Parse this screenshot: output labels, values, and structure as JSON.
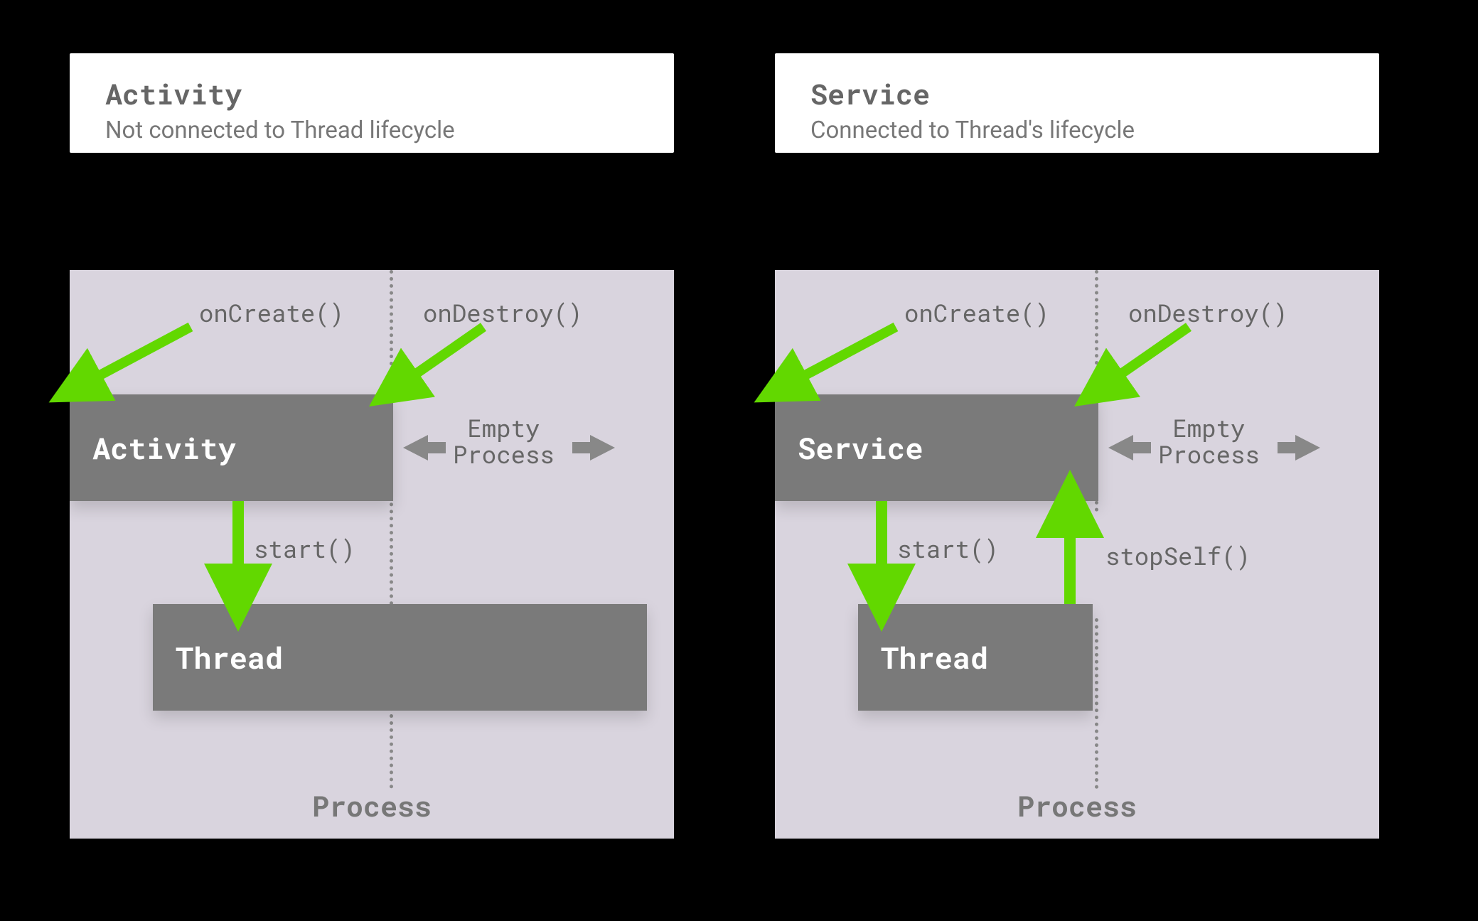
{
  "left": {
    "header_title": "Activity",
    "header_sub": "Not connected to Thread lifecycle",
    "onCreate": "onCreate()",
    "onDestroy": "onDestroy()",
    "component": "Activity",
    "empty1": "Empty",
    "empty2": "Process",
    "start": "start()",
    "thread": "Thread",
    "process": "Process"
  },
  "right": {
    "header_title": "Service",
    "header_sub": "Connected to Thread's lifecycle",
    "onCreate": "onCreate()",
    "onDestroy": "onDestroy()",
    "component": "Service",
    "empty1": "Empty",
    "empty2": "Process",
    "start": "start()",
    "stopSelf": "stopSelf()",
    "thread": "Thread",
    "process": "Process"
  },
  "colors": {
    "green": "#62d800",
    "gray_arrow": "#888"
  }
}
